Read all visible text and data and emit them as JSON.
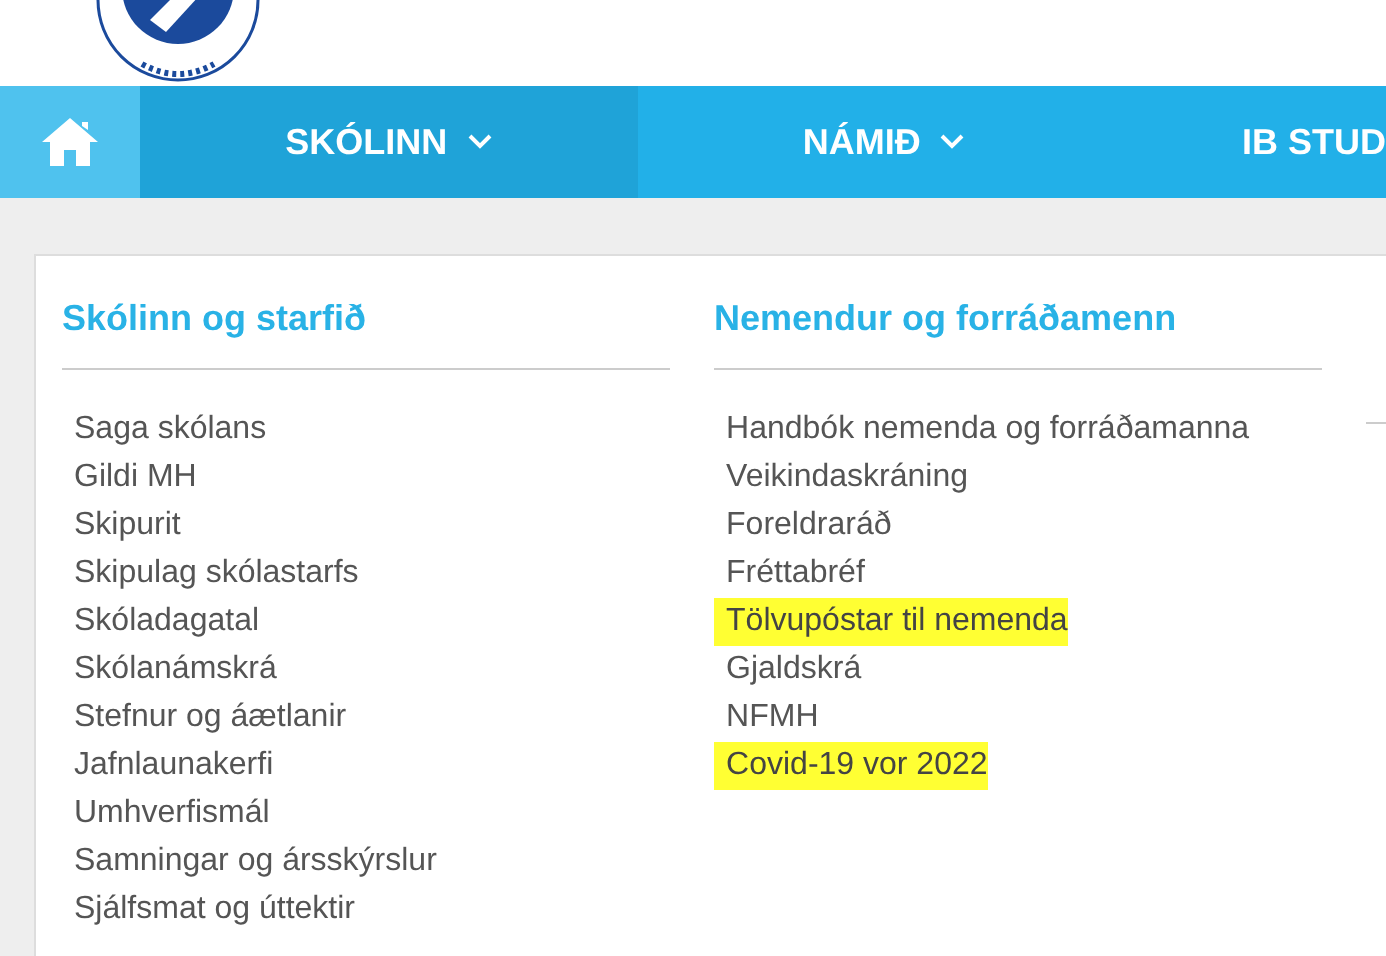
{
  "nav": {
    "items": [
      {
        "label": "SKÓLINN",
        "selected": true
      },
      {
        "label": "NÁMIÐ",
        "selected": false
      },
      {
        "label": "IB STUD",
        "selected": false
      }
    ]
  },
  "menu": {
    "columns": [
      {
        "heading": "Skólinn og starfið",
        "links": [
          {
            "label": "Saga skólans",
            "highlighted": false
          },
          {
            "label": "Gildi MH",
            "highlighted": false
          },
          {
            "label": "Skipurit",
            "highlighted": false
          },
          {
            "label": "Skipulag skólastarfs",
            "highlighted": false
          },
          {
            "label": "Skóladagatal",
            "highlighted": false
          },
          {
            "label": "Skólanámskrá",
            "highlighted": false
          },
          {
            "label": "Stefnur og áætlanir",
            "highlighted": false
          },
          {
            "label": "Jafnlaunakerfi",
            "highlighted": false
          },
          {
            "label": "Umhverfismál",
            "highlighted": false
          },
          {
            "label": "Samningar og ársskýrslur",
            "highlighted": false
          },
          {
            "label": "Sjálfsmat og úttektir",
            "highlighted": false
          }
        ]
      },
      {
        "heading": "Nemendur og forráðamenn",
        "links": [
          {
            "label": "Handbók nemenda og forráðamanna",
            "highlighted": false
          },
          {
            "label": "Veikindaskráning",
            "highlighted": false
          },
          {
            "label": "Foreldraráð",
            "highlighted": false
          },
          {
            "label": "Fréttabréf",
            "highlighted": false
          },
          {
            "label": "Tölvupóstar til nemenda",
            "highlighted": true
          },
          {
            "label": "Gjaldskrá",
            "highlighted": false
          },
          {
            "label": "NFMH",
            "highlighted": false
          },
          {
            "label": "Covid-19 vor 2022",
            "highlighted": true
          }
        ]
      }
    ]
  }
}
